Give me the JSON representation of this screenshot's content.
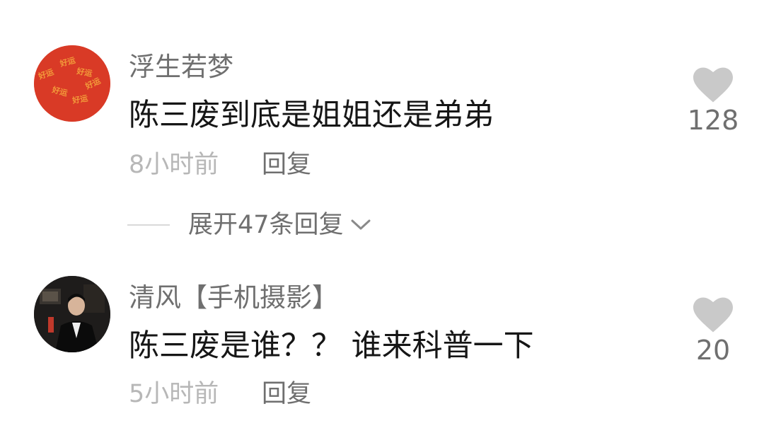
{
  "comments": [
    {
      "username": "浮生若梦",
      "text": "陈三废到底是姐姐还是弟弟",
      "time": "8小时前",
      "reply_label": "回复",
      "likes": "128",
      "avatar_text": "好运",
      "expand_label": "展开47条回复"
    },
    {
      "username": "清风【手机摄影】",
      "text": "陈三废是谁？？ 谁来科普一下",
      "time": "5小时前",
      "reply_label": "回复",
      "likes": "20"
    }
  ],
  "colors": {
    "avatar1_bg": "#d93a26",
    "avatar1_text": "#f29a3a",
    "like_icon": "#c9c9c9",
    "username": "#6f6f6f",
    "text": "#161616",
    "time": "#b7b7b7"
  }
}
